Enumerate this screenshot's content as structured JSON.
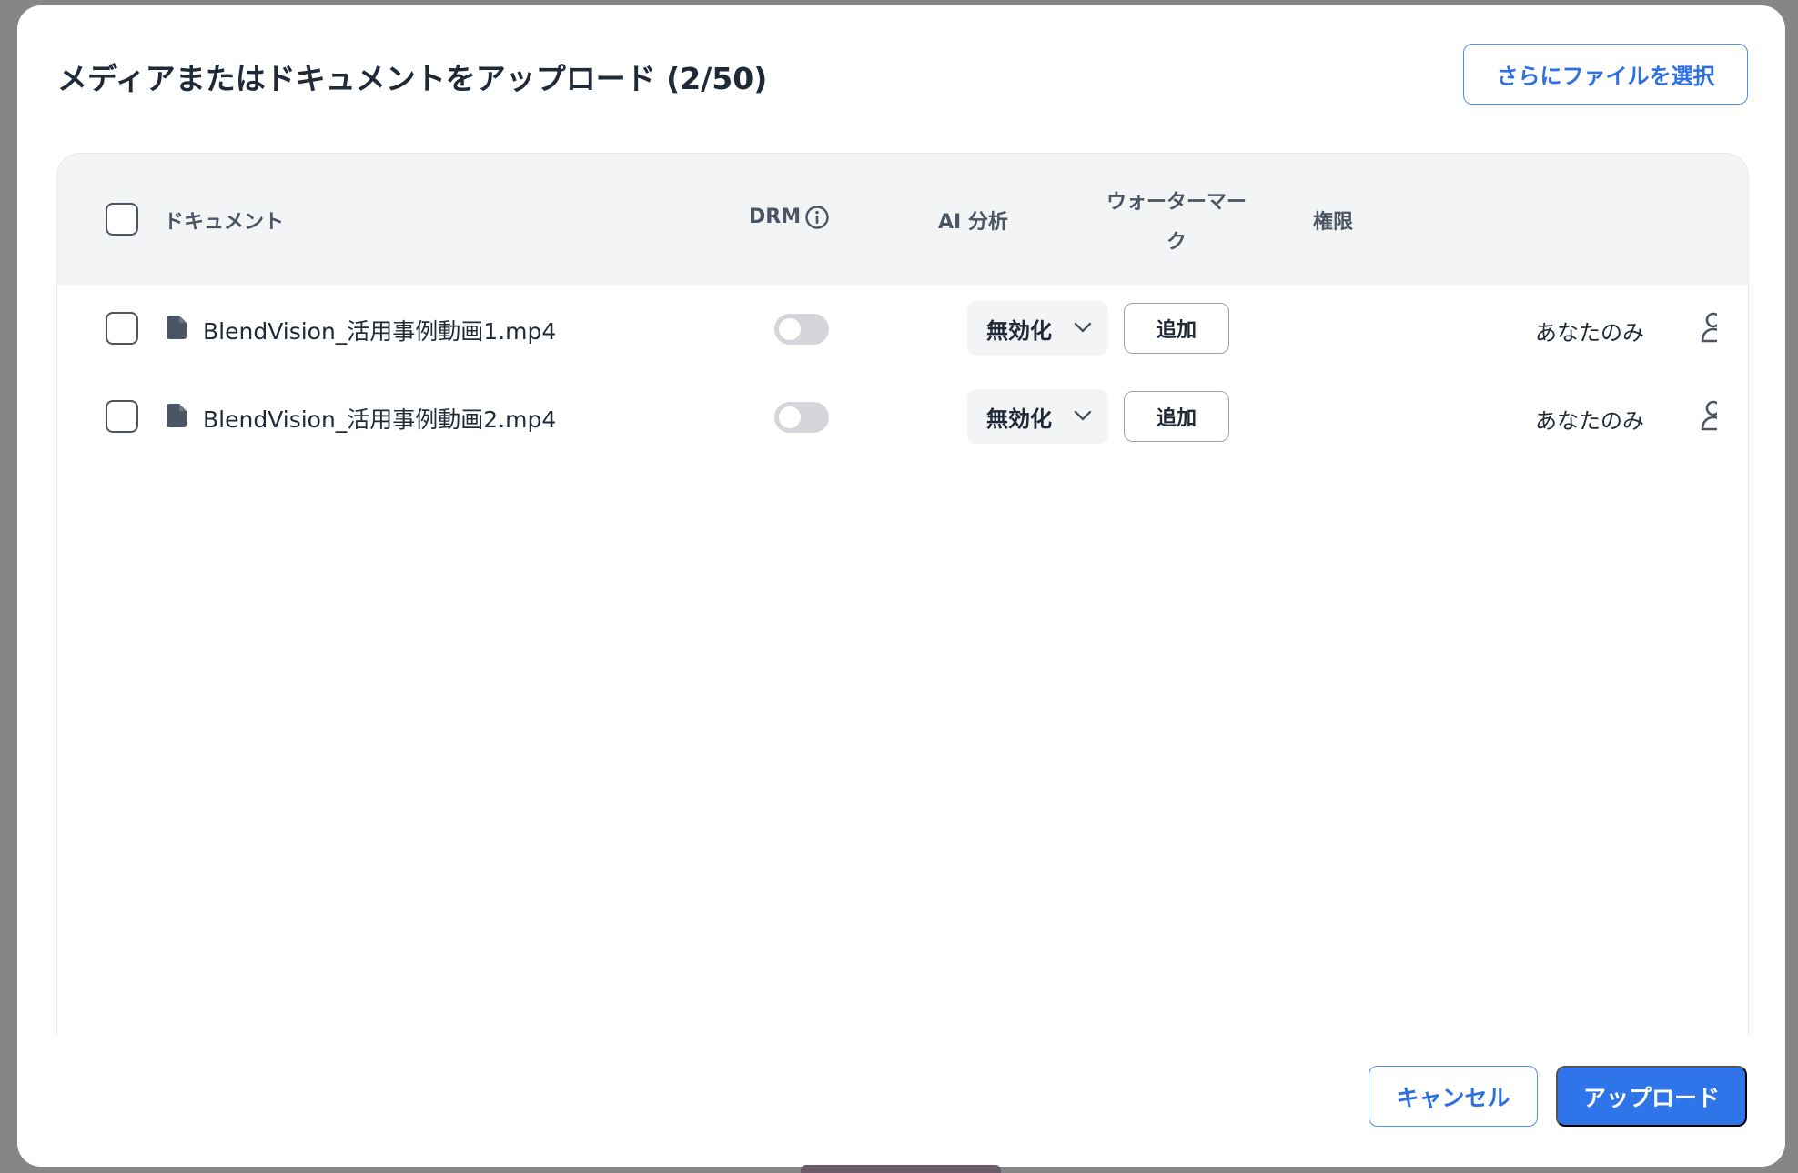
{
  "dialog": {
    "title": "メディアまたはドキュメントをアップロード (2/50)",
    "select_more_label": "さらにファイルを選択"
  },
  "table": {
    "headers": {
      "document": "ドキュメント",
      "drm": "DRM",
      "ai_analysis": "AI 分析",
      "watermark_line1": "ウォーターマー",
      "watermark_line2": "ク",
      "permission": "権限"
    },
    "rows": [
      {
        "filename": "BlendVision_活用事例動画1.mp4",
        "drm_enabled": false,
        "ai_analysis": "無効化",
        "watermark_button": "追加",
        "permission": "あなたのみ"
      },
      {
        "filename": "BlendVision_活用事例動画2.mp4",
        "drm_enabled": false,
        "ai_analysis": "無効化",
        "watermark_button": "追加",
        "permission": "あなたのみ"
      }
    ]
  },
  "footer": {
    "cancel_label": "キャンセル",
    "upload_label": "アップロード"
  },
  "icons": {
    "drm_info": "info-icon",
    "file": "file-icon",
    "dropdown": "chevron-down-icon",
    "permission": "person-icon"
  },
  "colors": {
    "accent": "#2f74e8",
    "accent_text": "#2f6fe4",
    "header_bg": "#f3f4f6",
    "toggle_off": "#d4d6da",
    "backdrop": "#858688"
  }
}
